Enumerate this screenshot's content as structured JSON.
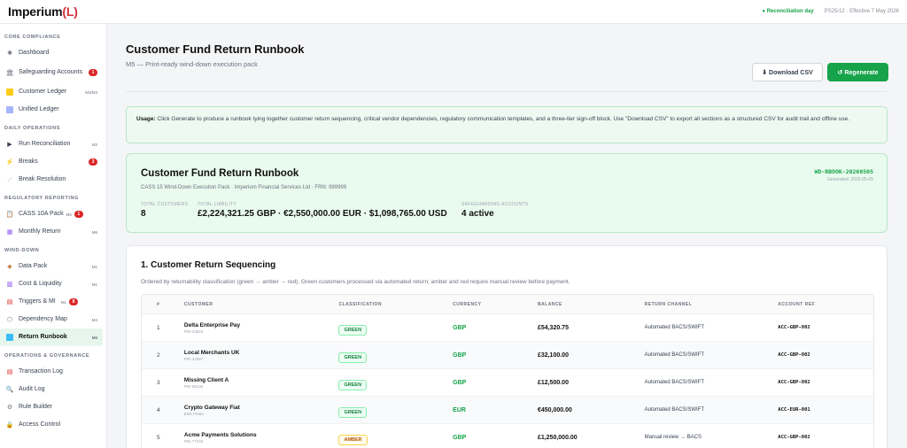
{
  "app": {
    "logo_main": "Imperium",
    "logo_accent": "(L)"
  },
  "topbar": {
    "status": "● Reconciliation day",
    "meta": "PS25/12 · Effective 7 May 2026"
  },
  "sidebar": {
    "sections": [
      {
        "title": "CORE COMPLIANCE"
      },
      {
        "title": "DAILY OPERATIONS"
      },
      {
        "title": "REGULATORY REPORTING"
      },
      {
        "title": "WIND-DOWN"
      },
      {
        "title": "OPERATIONS & GOVERNANCE"
      }
    ],
    "items": [
      {
        "label": "Dashboard",
        "icon": "dashboard-icon"
      },
      {
        "label": "Safeguarding Accounts",
        "badge": "1",
        "icon": "bank-icon"
      },
      {
        "label": "Customer Ledger",
        "tag": "M3/M4",
        "icon": "ledger-icon"
      },
      {
        "label": "Unified Ledger",
        "icon": "unified-ledger-icon"
      },
      {
        "label": "Run Reconciliation",
        "tag": "M2",
        "icon": "play-icon"
      },
      {
        "label": "Breaks",
        "badge": "3",
        "icon": "lightning-icon"
      },
      {
        "label": "Break Resolution",
        "icon": "wrench-icon"
      },
      {
        "label": "CASS 10A Pack",
        "tag": "M5",
        "badge": "1",
        "icon": "clipboard-icon"
      },
      {
        "label": "Monthly Return",
        "tag": "M6",
        "icon": "chart-icon"
      },
      {
        "label": "Data Pack",
        "tag": "M1",
        "icon": "package-icon"
      },
      {
        "label": "Cost & Liquidity",
        "tag": "M1",
        "icon": "cost-icon"
      },
      {
        "label": "Triggers & MI",
        "tag": "M1",
        "badge": "8",
        "icon": "trigger-icon"
      },
      {
        "label": "Dependency Map",
        "tag": "M4",
        "icon": "map-icon"
      },
      {
        "label": "Return Runbook",
        "tag": "M5",
        "icon": "book-icon"
      },
      {
        "label": "Transaction Log",
        "icon": "log-icon"
      },
      {
        "label": "Audit Log",
        "icon": "search-icon"
      },
      {
        "label": "Rule Builder",
        "icon": "gear-icon"
      },
      {
        "label": "Access Control",
        "icon": "lock-icon"
      }
    ]
  },
  "page": {
    "title": "Customer Fund Return Runbook",
    "subtitle": "M5 — Print-ready wind-down execution pack",
    "download_label": "⬇ Download CSV",
    "generate_label": "↺ Regenerate",
    "usage_label": "Usage:",
    "usage_text": " Click Generate to produce a runbook tying together customer return sequencing, critical vendor dependencies, regulatory communication templates, and a three-tier sign-off block. Use \"Download CSV\" to export all sections as a structured CSV for audit trail and offline use."
  },
  "runbook": {
    "title": "Customer Fund Return Runbook",
    "subtitle": "CASS 15 Wind-Down Execution Pack · Imperium Financial Services Ltd · FRN: 999999",
    "ref": "WD-RBOOK-20260505",
    "generated": "Generated: 2026-05-05",
    "stats": [
      {
        "label": "TOTAL CUSTOMERS",
        "value": "8"
      },
      {
        "label": "TOTAL LIABILITY",
        "value": "£2,224,321.25 GBP · €2,550,000.00 EUR · $1,098,765.00 USD"
      },
      {
        "label": "SAFEGUARDING ACCOUNTS",
        "value": "4 active"
      }
    ]
  },
  "sequencing": {
    "title": "1. Customer Return Sequencing",
    "description": "Ordered by returnability classification (green → amber → red). Green customers processed via automated return; amber and red require manual review before payment.",
    "headers": [
      "#",
      "CUSTOMER",
      "CLASSIFICATION",
      "CURRENCY",
      "BALANCE",
      "RETURN CHANNEL",
      "ACCOUNT REF"
    ],
    "rows": [
      {
        "n": "1",
        "name": "Delta Enterprise Pay",
        "id": "PID-44523",
        "class": "GREEN",
        "level": "green",
        "cur": "GBP",
        "bal": "£54,320.75",
        "chan": "Automated BACS/SWIFT",
        "acc": "ACC-GBP-002"
      },
      {
        "n": "2",
        "name": "Local Merchants UK",
        "id": "PID-22087",
        "class": "GREEN",
        "level": "green",
        "cur": "GBP",
        "bal": "£32,100.00",
        "chan": "Automated BACS/SWIFT",
        "acc": "ACC-GBP-002"
      },
      {
        "n": "3",
        "name": "Missing Client A",
        "id": "PID-55432",
        "class": "GREEN",
        "level": "green",
        "cur": "GBP",
        "bal": "£12,500.00",
        "chan": "Automated BACS/SWIFT",
        "acc": "ACC-GBP-002"
      },
      {
        "n": "4",
        "name": "Crypto Gateway Fiat",
        "id": "EMI-77654",
        "class": "GREEN",
        "level": "green",
        "cur": "EUR",
        "bal": "€450,000.00",
        "chan": "Automated BACS/SWIFT",
        "acc": "ACC-EUR-001"
      },
      {
        "n": "5",
        "name": "Acme Payments Solutions",
        "id": "PID-77342",
        "class": "AMBER",
        "level": "amber",
        "cur": "GBP",
        "bal": "£1,250,000.00",
        "chan": "Manual review → BACS",
        "acc": "ACC-GBP-002"
      }
    ]
  }
}
